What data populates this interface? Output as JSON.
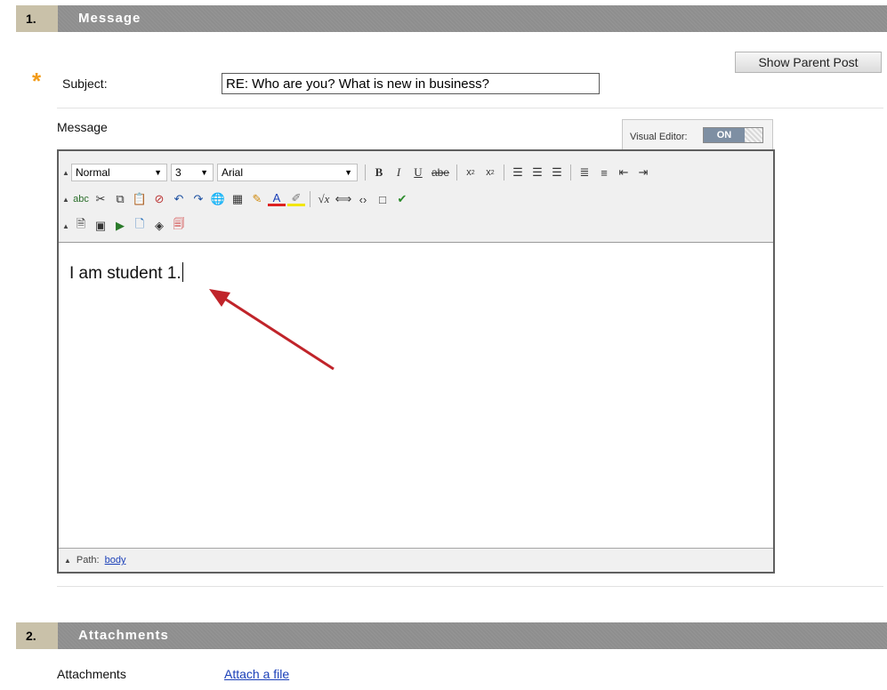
{
  "section1": {
    "number": "1.",
    "title": "Message"
  },
  "show_parent_post": "Show Parent Post",
  "subject": {
    "required_mark": "*",
    "label": "Subject:",
    "value": "RE: Who are you? What is new in business?"
  },
  "message_label": "Message",
  "visual_editor": {
    "label": "Visual Editor:",
    "state": "ON"
  },
  "toolbar": {
    "format": "Normal",
    "size": "3",
    "font": "Arial",
    "row1": [
      "bold-icon",
      "italic-icon",
      "underline-icon",
      "strikethrough-icon",
      "subscript-icon",
      "superscript-icon",
      "align-left-icon",
      "align-center-icon",
      "align-right-icon",
      "numbered-list-icon",
      "bulleted-list-icon",
      "outdent-icon",
      "indent-icon"
    ],
    "row2": [
      "spellcheck-icon",
      "cut-icon",
      "copy-icon",
      "paste-icon",
      "clear-format-icon",
      "undo-icon",
      "redo-icon",
      "link-icon",
      "table-icon",
      "pencil-icon",
      "text-color-icon",
      "highlight-icon",
      "math-icon",
      "code-arrows-icon",
      "html-icon",
      "fullscreen-icon",
      "check-icon"
    ],
    "row3": [
      "insert-file-icon",
      "insert-image-icon",
      "insert-media-icon",
      "insert-link-file-icon",
      "mashup-icon",
      "insert-pdf-icon"
    ]
  },
  "editor_content": "I am student 1.",
  "status": {
    "path_label": "Path:",
    "path_value": "body"
  },
  "section2": {
    "number": "2.",
    "title": "Attachments"
  },
  "attachments": {
    "label": "Attachments",
    "link": "Attach a file"
  },
  "colors": {
    "section_number_bg": "#c9c1a9",
    "section_title_bg": "#8e8e8e",
    "required": "#f29b18",
    "link": "#1a3fb8",
    "annotation_arrow": "#c0242a"
  }
}
